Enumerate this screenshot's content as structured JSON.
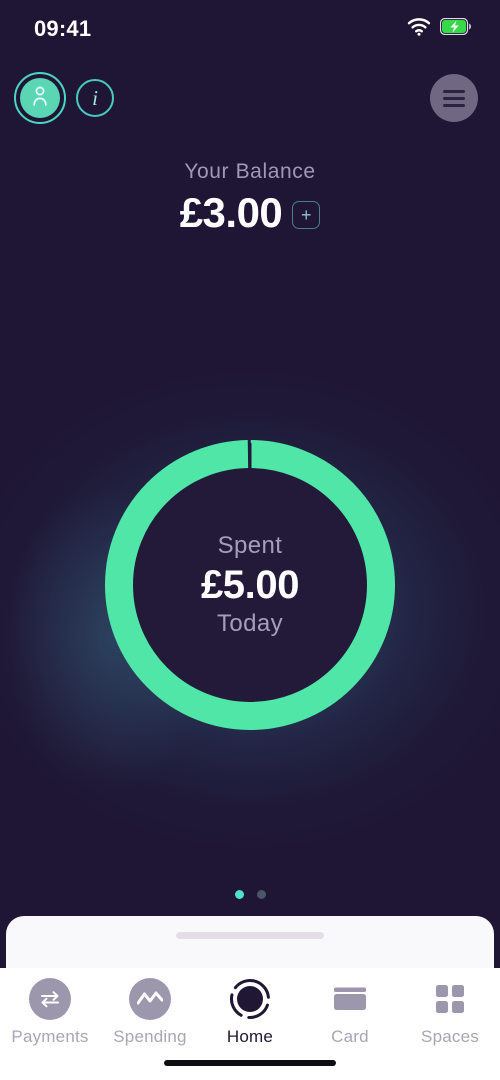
{
  "status_bar": {
    "time": "09:41",
    "wifi_icon": "wifi-icon",
    "battery_icon": "battery-charging-icon"
  },
  "header": {
    "avatar_icon": "person-icon",
    "info_icon": "info-icon",
    "info_label": "i",
    "menu_icon": "hamburger-menu-icon"
  },
  "balance": {
    "label": "Your Balance",
    "amount": "£3.00",
    "add_label": "+",
    "add_icon": "plus-icon"
  },
  "spending_ring": {
    "label": "Spent",
    "amount": "£5.00",
    "period": "Today",
    "progress_percent": 100,
    "ring_color": "#4fe6a8",
    "track_color": "#231a3a"
  },
  "pagination": {
    "total": 2,
    "active_index": 0,
    "active_color": "#4fe0cf",
    "inactive_color": "#4a5568"
  },
  "sheet": {
    "handle_icon": "drag-handle-icon"
  },
  "tabbar": {
    "items": [
      {
        "label": "Payments",
        "icon": "transfer-arrows-icon",
        "active": false
      },
      {
        "label": "Spending",
        "icon": "line-chart-icon",
        "active": false
      },
      {
        "label": "Home",
        "icon": "home-ring-icon",
        "active": true
      },
      {
        "label": "Card",
        "icon": "credit-card-icon",
        "active": false
      },
      {
        "label": "Spaces",
        "icon": "grid-squares-icon",
        "active": false
      }
    ]
  },
  "theme": {
    "background": "#1f1635",
    "accent_green": "#4fe6a8",
    "accent_teal": "#49c9c2",
    "muted_text": "#a197b8"
  }
}
